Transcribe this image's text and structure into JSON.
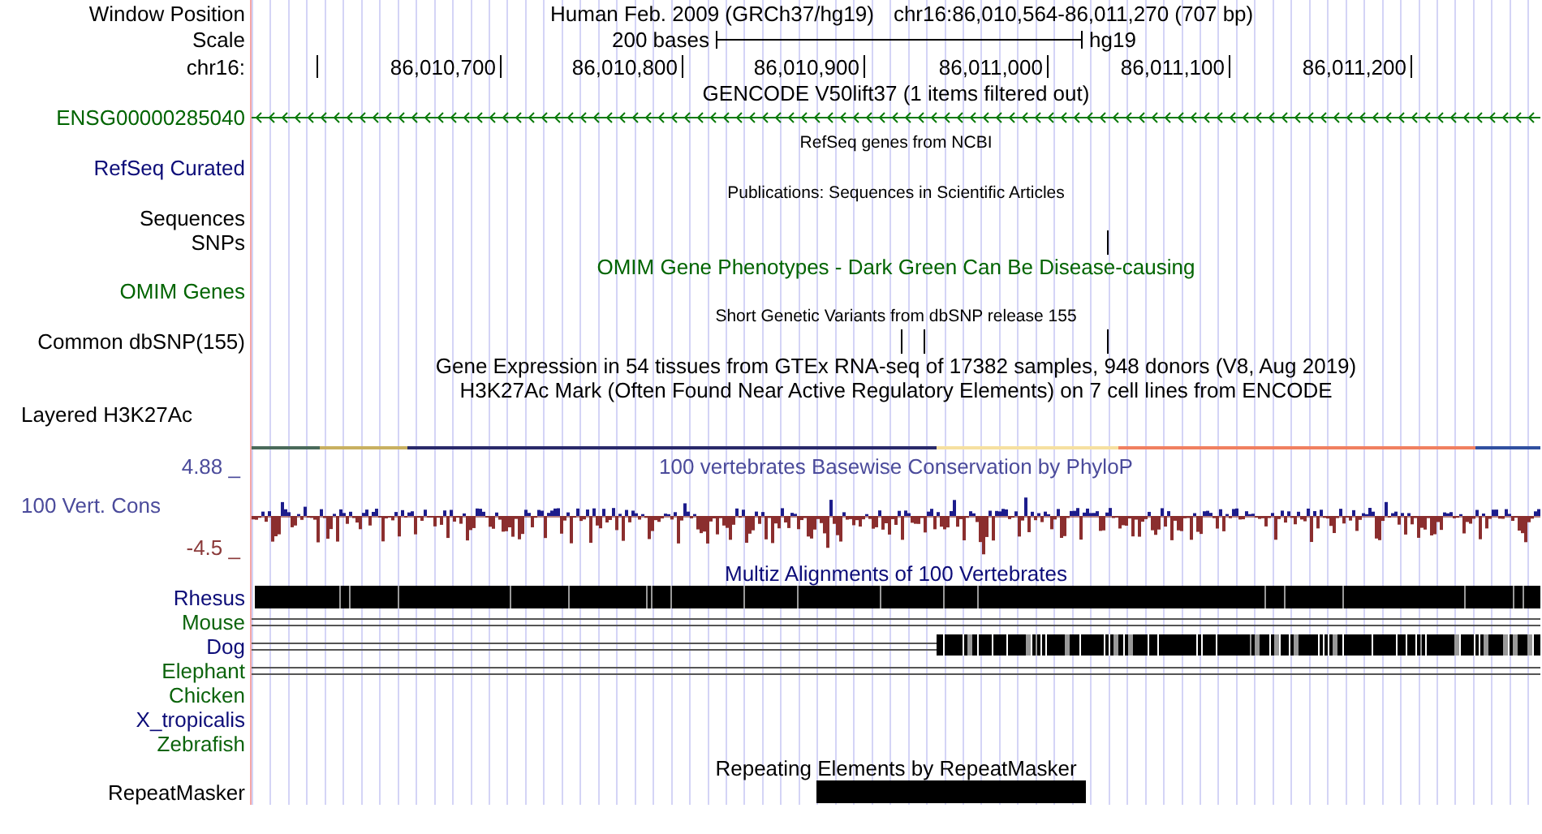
{
  "position": {
    "label": "Window Position",
    "assembly": "Human Feb. 2009 (GRCh37/hg19)",
    "range": "chr16:86,010,564-86,011,270 (707 bp)"
  },
  "scale": {
    "label": "Scale",
    "span": "200 bases",
    "db": "hg19"
  },
  "ruler": {
    "label": "chr16:",
    "ticks": [
      "86,010,700",
      "86,010,800",
      "86,010,900",
      "86,011,000",
      "86,011,100",
      "86,011,200"
    ]
  },
  "rows": [
    {
      "kind": "title",
      "text": "GENCODE V50lift37 (1 items filtered out)",
      "color": "#000000"
    },
    {
      "kind": "gene",
      "label": "ENSG00000285040",
      "color": "#006400"
    },
    {
      "kind": "caption",
      "text": "RefSeq genes from NCBI"
    },
    {
      "kind": "empty",
      "label": "RefSeq Curated",
      "color": "#0c0c78"
    },
    {
      "kind": "caption",
      "text": "Publications: Sequences in Scientific Articles"
    },
    {
      "kind": "empty",
      "label": "Sequences",
      "color": "#000000"
    },
    {
      "kind": "ticks",
      "label": "SNPs",
      "color": "#000000"
    },
    {
      "kind": "title",
      "text": "OMIM Gene Phenotypes - Dark Green Can Be Disease-causing",
      "color": "#006400"
    },
    {
      "kind": "empty",
      "label": "OMIM Genes",
      "color": "#006400"
    },
    {
      "kind": "caption",
      "text": "Short Genetic Variants from dbSNP release 155"
    },
    {
      "kind": "ticks",
      "label": "Common dbSNP(155)",
      "color": "#000000"
    },
    {
      "kind": "title",
      "text": "Gene Expression in 54 tissues from GTEx RNA-seq of 17382 samples, 948 donors (V8, Aug 2019)",
      "color": "#000000"
    },
    {
      "kind": "title",
      "text": "H3K27Ac Mark (Often Found Near Active Regulatory Elements) on 7 cell lines from ENCODE",
      "color": "#000000"
    },
    {
      "kind": "layered",
      "label": "Layered H3K27Ac",
      "color": "#000000"
    },
    {
      "kind": "wiggle",
      "label": "100 Vert. Cons",
      "color": "#4b4b9b",
      "title": "100 vertebrates Basewise Conservation by PhyloP",
      "max": "4.88 _",
      "min": "-4.5 _"
    },
    {
      "kind": "title",
      "text": "Multiz Alignments of 100 Vertebrates",
      "color": "#0c0c78"
    },
    {
      "kind": "block",
      "label": "Rhesus",
      "color": "#0c0c78"
    },
    {
      "kind": "double",
      "label": "Mouse",
      "color": "#0c640c"
    },
    {
      "kind": "partial",
      "label": "Dog",
      "color": "#0c0c78"
    },
    {
      "kind": "double",
      "label": "Elephant",
      "color": "#0c640c"
    },
    {
      "kind": "empty",
      "label": "Chicken",
      "color": "#0c640c"
    },
    {
      "kind": "empty",
      "label": "X_tropicalis",
      "color": "#0c0c78"
    },
    {
      "kind": "empty",
      "label": "Zebrafish",
      "color": "#0c640c"
    },
    {
      "kind": "title",
      "text": "Repeating Elements by RepeatMasker",
      "color": "#000000"
    },
    {
      "kind": "repeat",
      "label": "RepeatMasker",
      "color": "#000000"
    }
  ]
}
